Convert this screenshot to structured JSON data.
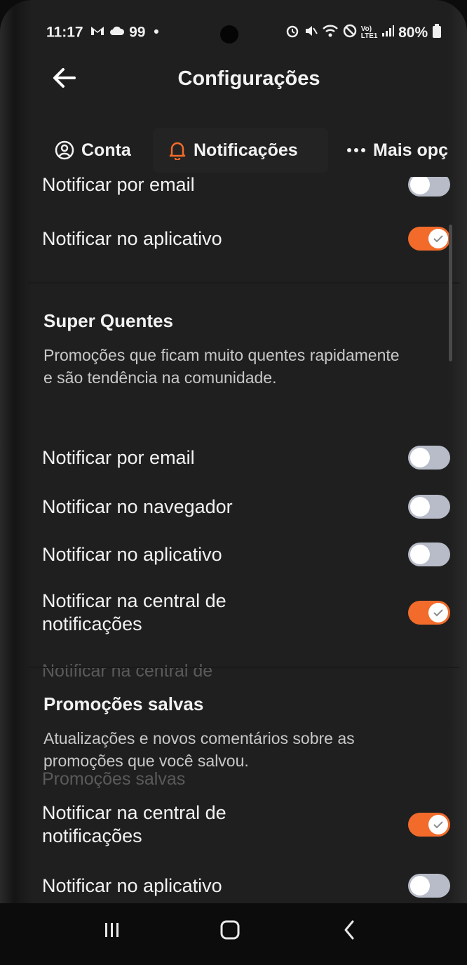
{
  "status_bar": {
    "time": "11:17",
    "battery": "80%",
    "signal_text": "Vo) LTE1"
  },
  "app_bar": {
    "title": "Configurações"
  },
  "tabs": [
    {
      "label": "Conta",
      "icon": "user-circle-icon"
    },
    {
      "label": "Notificações",
      "icon": "bell-icon"
    },
    {
      "label": "Mais opç",
      "icon": "more-dots-icon"
    }
  ],
  "accent_color": "#f26b2a",
  "top_section": {
    "partial_label": "Notificar por email",
    "rows": [
      {
        "label": "Notificar no aplicativo",
        "enabled": true
      }
    ]
  },
  "super_quentes": {
    "title": "Super Quentes",
    "description": "Promoções que ficam muito quentes rapidamente e são tendência na comunidade.",
    "rows": [
      {
        "label": "Notificar por email",
        "enabled": false
      },
      {
        "label": "Notificar no navegador",
        "enabled": false
      },
      {
        "label": "Notificar no aplicativo",
        "enabled": false
      },
      {
        "label": "Notificar na central de notificações",
        "enabled": true
      }
    ]
  },
  "promocoes_salvas": {
    "title": "Promoções salvas",
    "description": "Atualizações e novos comentários sobre as promoções que você salvou.",
    "rows": [
      {
        "label": "Notificar na central de notificações",
        "enabled": true
      },
      {
        "label": "Notificar no aplicativo",
        "enabled": false
      }
    ]
  },
  "ghost_texts": {
    "notif_central": "Notificar na central de",
    "promocoes_salvas": "Promoções salvas"
  },
  "nav_bar": {
    "recents": "recents-icon",
    "home": "home-icon",
    "back": "back-icon"
  }
}
